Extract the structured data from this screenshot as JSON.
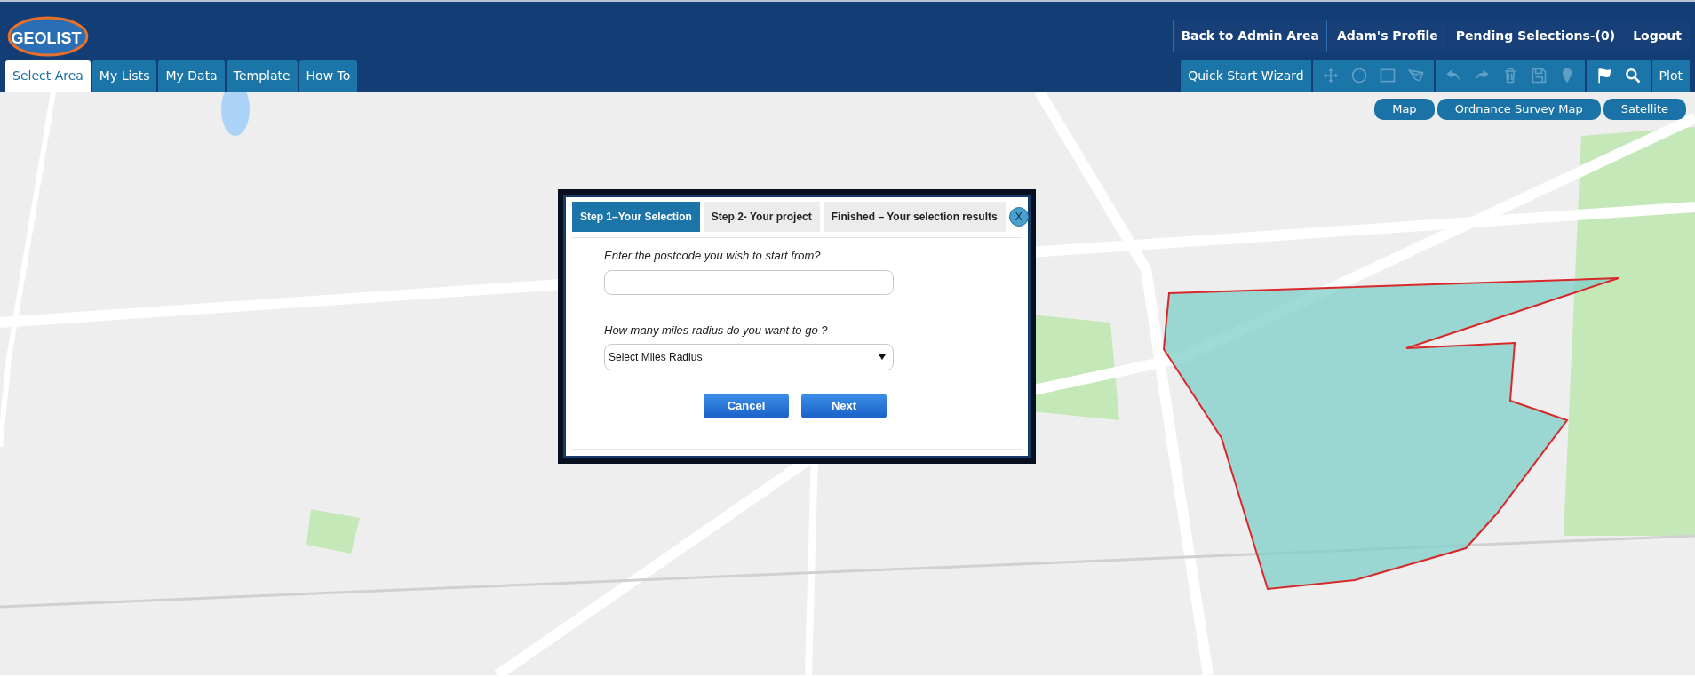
{
  "header": {
    "logo": {
      "text": "GEOLIST"
    },
    "links": [
      {
        "label": "Back to Admin Area",
        "selected": true
      },
      {
        "label": "Adam's Profile",
        "selected": false
      },
      {
        "label": "Pending Selections-(0)",
        "selected": false
      },
      {
        "label": "Logout",
        "selected": false
      }
    ]
  },
  "tabs": [
    {
      "label": "Select Area",
      "selected": true
    },
    {
      "label": "My Lists",
      "selected": false
    },
    {
      "label": "My Data",
      "selected": false
    },
    {
      "label": "Template",
      "selected": false
    },
    {
      "label": "How To",
      "selected": false
    }
  ],
  "toolbar": {
    "wizard": "Quick Start Wizard",
    "groups": [
      [
        {
          "kind": "move",
          "disabled": true
        },
        {
          "kind": "circle",
          "disabled": true
        },
        {
          "kind": "square",
          "disabled": true
        },
        {
          "kind": "polygon",
          "disabled": true
        }
      ],
      [
        {
          "kind": "undo",
          "disabled": true
        },
        {
          "kind": "redo",
          "disabled": true
        },
        {
          "kind": "trash",
          "disabled": true
        },
        {
          "kind": "save",
          "disabled": true
        },
        {
          "kind": "pin",
          "disabled": true
        }
      ],
      [
        {
          "kind": "flag",
          "disabled": false
        },
        {
          "kind": "search",
          "disabled": false
        }
      ]
    ],
    "plot": "Plot"
  },
  "map_types": [
    {
      "label": "Map"
    },
    {
      "label": "Ordnance Survey Map"
    },
    {
      "label": "Satellite"
    }
  ],
  "dialog": {
    "close": "X",
    "steps": [
      {
        "label": "Step 1–Your Selection",
        "selected": true
      },
      {
        "label": "Step 2- Your project",
        "selected": false
      },
      {
        "label": "Finished – Your selection results",
        "selected": false
      }
    ],
    "postcode": {
      "label": "Enter the postcode you wish to start from?"
    },
    "radius": {
      "label": "How many miles radius do you want to go ?",
      "value": "Select Miles Radius"
    },
    "buttons": [
      "Cancel",
      "Next"
    ]
  }
}
